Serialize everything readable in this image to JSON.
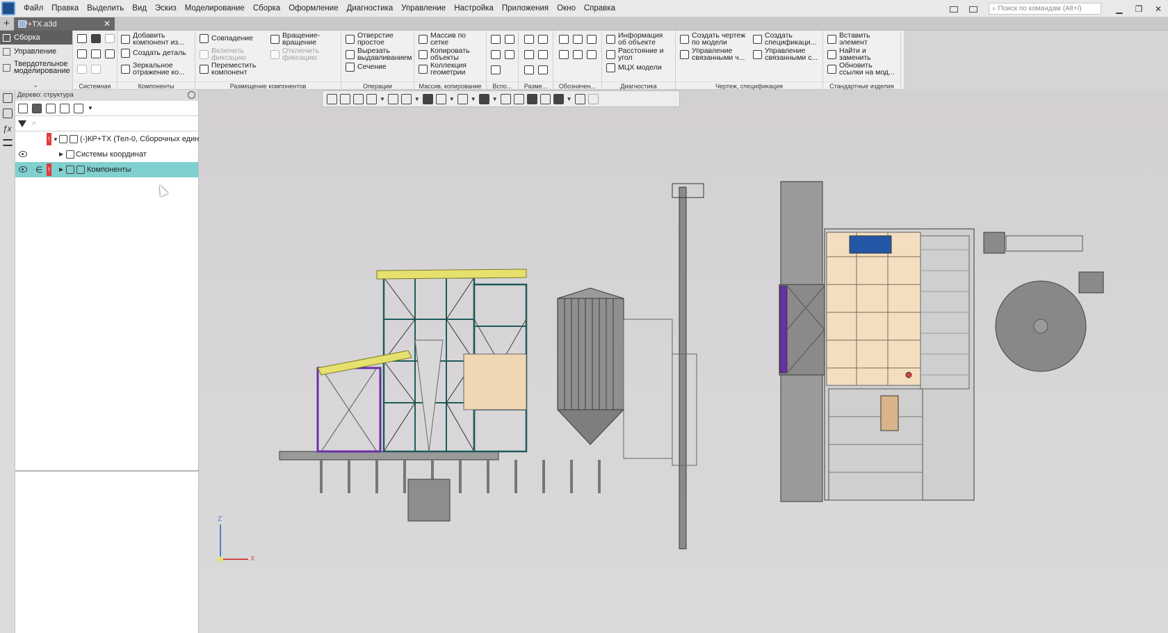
{
  "menubar": {
    "items": [
      "Файл",
      "Правка",
      "Выделить",
      "Вид",
      "Эскиз",
      "Моделирование",
      "Сборка",
      "Оформление",
      "Диагностика",
      "Управление",
      "Настройка",
      "Приложения",
      "Окно",
      "Справка"
    ],
    "search_placeholder": "Поиск по командам (Alt+/)"
  },
  "doc_tab": {
    "title": "КР+ТХ.a3d"
  },
  "ribbon": {
    "left": [
      "Сборка",
      "Управление",
      "Твердотельное моделирование"
    ],
    "groups": {
      "system": "Системная",
      "components": "Компоненты",
      "placement": "Размещение компонентов",
      "operations": "Операции",
      "array": "Массив, копирование",
      "aux": "Вспо...",
      "dims": "Разме...",
      "notation": "Обозначен...",
      "diagnostics": "Диагностика",
      "drawing": "Чертеж, спецификация",
      "std": "Стандартные изделия"
    },
    "buttons": {
      "add_component": "Добавить\nкомпонент из...",
      "create_part": "Создать деталь",
      "mirror": "Зеркальное\nотражение ко...",
      "coincidence": "Совпадение",
      "fix_on": "Включить\nфиксацию",
      "move": "Переместить\nкомпонент",
      "rotate": "Вращение-\nвращение",
      "fix_off": "Отключить\nфиксацию",
      "hole": "Отверстие\nпростое",
      "cut_extrude": "Вырезать\nвыдавливанием",
      "section": "Сечение",
      "grid_array": "Массив по\nсетке",
      "copy_obj": "Копировать\nобъекты",
      "geom_collection": "Коллекция\nгеометрии",
      "obj_info": "Информация\nоб объекте",
      "distance": "Расстояние и\nугол",
      "mcx": "МЦХ модели",
      "make_drawing": "Создать чертеж\nпо модели",
      "manage_linked_dr": "Управление\nсвязанными ч...",
      "make_spec": "Создать\nспецификаци...",
      "manage_linked_sp": "Управление\nсвязанными с...",
      "insert_elem": "Вставить\nэлемент",
      "find_replace": "Найти и\nзаменить",
      "update_links": "Обновить\nссылки на мод..."
    }
  },
  "tree": {
    "panel_title": "Дерево: структура",
    "filter_placeholder": "",
    "rows": [
      {
        "label": "(-)КР+ТХ (Тел-0, Сборочных един"
      },
      {
        "label": "Системы координат"
      },
      {
        "label": "Компоненты"
      }
    ]
  },
  "colors": {
    "accent_selection": "#7fd0cf",
    "error": "#e23b3b",
    "model_purple": "#6a2fa8",
    "model_yellow": "#e6e06e"
  },
  "axes": {
    "x": "X",
    "z": "Z"
  }
}
